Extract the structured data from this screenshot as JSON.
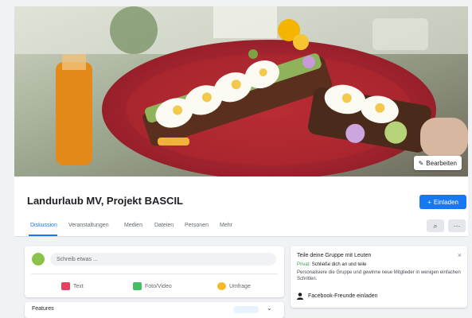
{
  "cover": {
    "edit_label": "Bearbeiten"
  },
  "header": {
    "group_name": "Landurlaub MV, Projekt BASCIL",
    "invite_label": "Einladen"
  },
  "tabs": [
    {
      "label": "Diskussion",
      "active": true
    },
    {
      "label": "Veranstaltungen"
    },
    {
      "label": "Medien"
    },
    {
      "label": "Dateien"
    },
    {
      "label": "Personen"
    },
    {
      "label": "Mehr"
    }
  ],
  "composer": {
    "placeholder": "Schreib etwas ...",
    "actions": [
      {
        "label": "Text",
        "icon": "text-icon",
        "color": "#e4405f"
      },
      {
        "label": "Foto/Video",
        "icon": "photo-video-icon",
        "color": "#45bd62"
      },
      {
        "label": "Umfrage",
        "icon": "poll-icon",
        "color": "#f7b928"
      }
    ]
  },
  "features": {
    "label": "Features"
  },
  "suggestion_card": {
    "title": "Teile deine Gruppe mit Leuten",
    "status_prefix": "Privat:",
    "status_text": "Schließe dich an und teile",
    "description": "Personalisiere die Gruppe und gewinne neue Mitglieder in wenigen einfachen Schritten.",
    "contact_label": "Facebook-Freunde einladen"
  },
  "colors": {
    "accent": "#1877f2",
    "page_bg": "#f0f2f5"
  }
}
